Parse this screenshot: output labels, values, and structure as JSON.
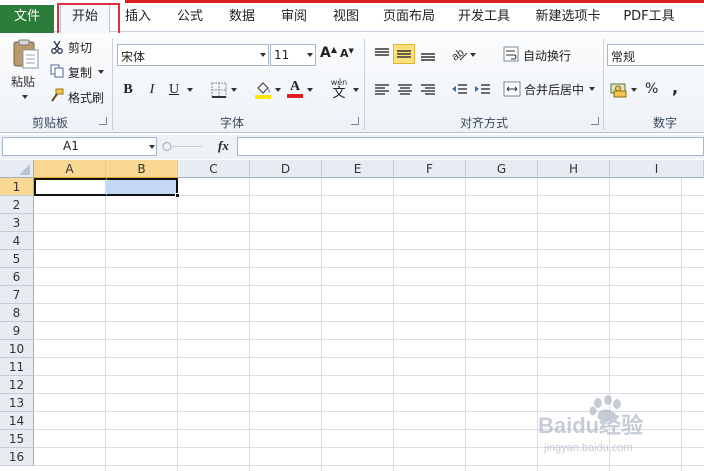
{
  "tabs": {
    "file": "文件",
    "home": "开始",
    "insert": "插入",
    "formulas": "公式",
    "data": "数据",
    "review": "审阅",
    "view": "视图",
    "page_layout": "页面布局",
    "developer": "开发工具",
    "new_tab": "新建选项卡",
    "pdf": "PDF工具"
  },
  "clipboard": {
    "paste": "粘贴",
    "cut": "剪切",
    "copy": "复制",
    "format_painter": "格式刷",
    "group_label": "剪贴板"
  },
  "font": {
    "name": "宋体",
    "size": "11",
    "bold": "B",
    "italic": "I",
    "underline": "U",
    "grow": "A",
    "shrink": "A",
    "font_color_glyph": "A",
    "wen": "文",
    "group_label": "字体"
  },
  "alignment": {
    "wrap_text": "自动换行",
    "merge_center": "合并后居中",
    "group_label": "对齐方式"
  },
  "number": {
    "format": "常规",
    "percent": "%",
    "comma": ",",
    "group_label": "数字"
  },
  "formula_bar": {
    "name_box": "A1",
    "fx": "fx",
    "value": ""
  },
  "columns": [
    "A",
    "B",
    "C",
    "D",
    "E",
    "F",
    "G",
    "H",
    "I"
  ],
  "rows": [
    "1",
    "2",
    "3",
    "4",
    "5",
    "6",
    "7",
    "8",
    "9",
    "10",
    "11",
    "12",
    "13",
    "14",
    "15",
    "16"
  ],
  "watermark": {
    "brand": "Baidu经验",
    "url": "jingyan.baidu.com"
  },
  "colors": {
    "file_tab": "#2c7c3b",
    "highlight_red": "#e0303a",
    "selected_header": "#f9d891",
    "selected_cell": "#c3d8f3",
    "font_color": "#e02020",
    "fill_color": "#ffe400"
  }
}
